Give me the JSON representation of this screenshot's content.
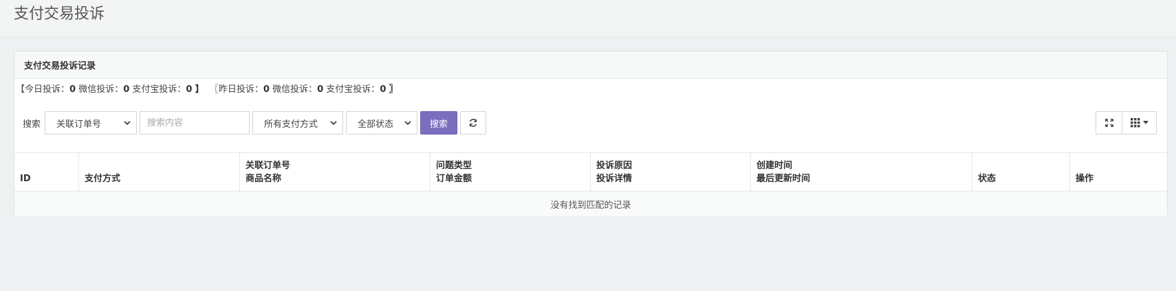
{
  "page": {
    "title": "支付交易投诉"
  },
  "panel": {
    "heading": "支付交易投诉记录"
  },
  "stats": {
    "today_open": "【今日投诉：",
    "today_total": "0",
    "today_wechat_label": "微信投诉：",
    "today_wechat": "0",
    "today_alipay_label": "支付宝投诉：",
    "today_alipay": "0",
    "today_close": "】",
    "yesterday_open": "〖昨日投诉：",
    "yesterday_total": "0",
    "yesterday_wechat_label": "微信投诉：",
    "yesterday_wechat": "0",
    "yesterday_alipay_label": "支付宝投诉：",
    "yesterday_alipay": "0",
    "yesterday_close": "〗"
  },
  "toolbar": {
    "search_label": "搜索",
    "field_select": "关联订单号",
    "search_placeholder": "搜索内容",
    "search_value": "",
    "payment_select": "所有支付方式",
    "status_select": "全部状态",
    "search_button": "搜索"
  },
  "icons": {
    "refresh": "refresh-icon",
    "fullscreen": "fullscreen-icon",
    "columns": "columns-grid-icon",
    "caret": "caret-down-icon"
  },
  "colors": {
    "accent": "#7c6dbf",
    "background": "#eef1f1"
  },
  "table": {
    "columns": [
      {
        "line1": "",
        "line2": "ID"
      },
      {
        "line1": "",
        "line2": "支付方式"
      },
      {
        "line1": "关联订单号",
        "line2": "商品名称"
      },
      {
        "line1": "问题类型",
        "line2": "订单金额"
      },
      {
        "line1": "投诉原因",
        "line2": "投诉详情"
      },
      {
        "line1": "创建时间",
        "line2": "最后更新时间"
      },
      {
        "line1": "",
        "line2": "状态"
      },
      {
        "line1": "",
        "line2": "操作"
      }
    ],
    "empty_message": "没有找到匹配的记录"
  }
}
